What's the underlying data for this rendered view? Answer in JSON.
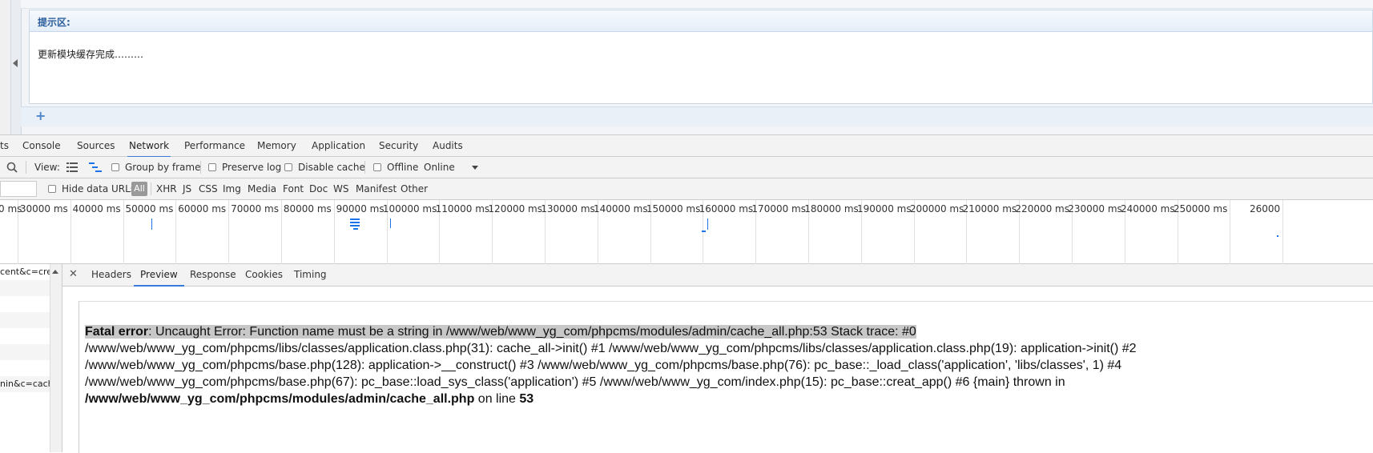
{
  "page": {
    "notice_title": "提示区:",
    "notice_message": "更新模块缓存完成………",
    "plus": "+"
  },
  "devtools": {
    "tabs": [
      "ts",
      "Console",
      "Sources",
      "Network",
      "Performance",
      "Memory",
      "Application",
      "Security",
      "Audits"
    ],
    "active_tab": "Network",
    "toolbar": {
      "view_label": "View:",
      "group_by_frame": "Group by frame",
      "preserve_log": "Preserve log",
      "disable_cache": "Disable cache",
      "offline": "Offline",
      "throttle": "Online"
    },
    "filter": {
      "hide_data_urls": "Hide data URLs",
      "all": "All",
      "types": [
        "XHR",
        "JS",
        "CSS",
        "Img",
        "Media",
        "Font",
        "Doc",
        "WS",
        "Manifest",
        "Other"
      ]
    },
    "timeline_ticks": [
      "0 ms",
      "30000 ms",
      "40000 ms",
      "50000 ms",
      "60000 ms",
      "70000 ms",
      "80000 ms",
      "90000 ms",
      "100000 ms",
      "110000 ms",
      "120000 ms",
      "130000 ms",
      "140000 ms",
      "150000 ms",
      "160000 ms",
      "170000 ms",
      "180000 ms",
      "190000 ms",
      "200000 ms",
      "210000 ms",
      "220000 ms",
      "230000 ms",
      "240000 ms",
      "250000 ms",
      "26000"
    ],
    "requests": [
      {
        "name": "cent&c=crea"
      },
      {
        "name": ""
      },
      {
        "name": ""
      },
      {
        "name": ""
      },
      {
        "name": ""
      },
      {
        "name": ""
      },
      {
        "name": ""
      },
      {
        "name": "nin&c=cache"
      },
      {
        "name": ""
      }
    ],
    "detail_tabs": [
      "Headers",
      "Preview",
      "Response",
      "Cookies",
      "Timing"
    ],
    "active_detail_tab": "Preview",
    "accent_color": "#3879d9"
  },
  "preview": {
    "error_label": "Fatal error",
    "line1": ": Uncaught Error: Function name must be a string in /www/web/www_yg_com/phpcms/modules/admin/cache_all.php:53 Stack trace: #0",
    "line2": "/www/web/www_yg_com/phpcms/libs/classes/application.class.php(31): cache_all->init() #1 /www/web/www_yg_com/phpcms/libs/classes/application.class.php(19): application->init() #2",
    "line3": "/www/web/www_yg_com/phpcms/base.php(128): application->__construct() #3 /www/web/www_yg_com/phpcms/base.php(76): pc_base::_load_class('application', 'libs/classes', 1) #4",
    "line4": "/www/web/www_yg_com/phpcms/base.php(67): pc_base::load_sys_class('application') #5 /www/web/www_yg_com/index.php(15): pc_base::creat_app() #6 {main} thrown in",
    "file": "/www/web/www_yg_com/phpcms/modules/admin/cache_all.php",
    "on_line": " on line ",
    "line_no": "53"
  }
}
